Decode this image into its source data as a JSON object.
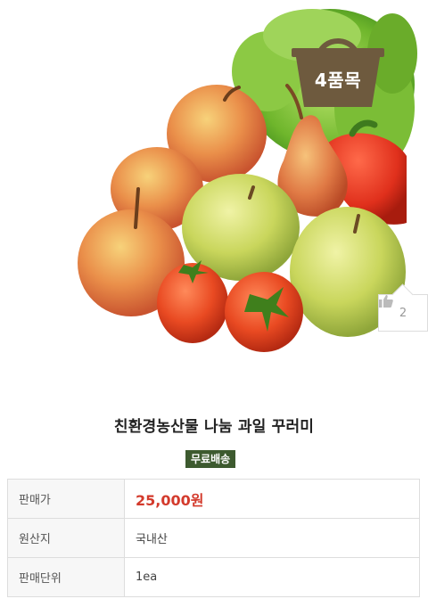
{
  "hero": {
    "basket_badge": "4품목",
    "like_count": "2"
  },
  "product": {
    "title": "친환경농산물 나눔 과일 꾸러미",
    "shipping_badge": "무료배송"
  },
  "info_rows": [
    {
      "label": "판매가",
      "value": "25,000원"
    },
    {
      "label": "원산지",
      "value": "국내산"
    },
    {
      "label": "판매단위",
      "value": "1ea"
    }
  ],
  "colors": {
    "price": "#d33a2c",
    "badge_bg": "#3d5a2f",
    "basket": "#6e5a3e"
  },
  "icons": {
    "like": "thumbs-up-icon",
    "basket": "basket-icon"
  }
}
